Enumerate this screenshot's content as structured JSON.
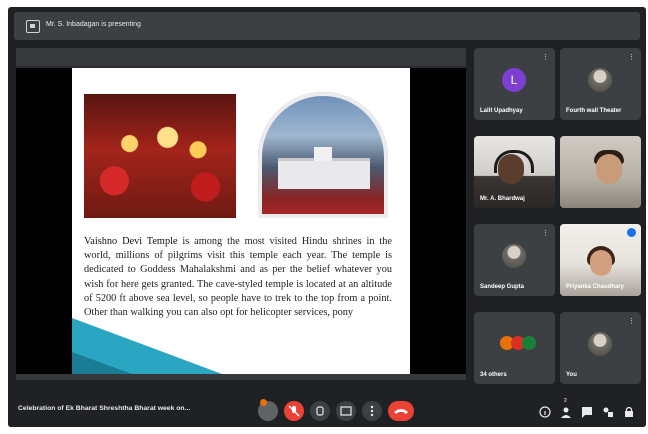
{
  "topbar": {
    "presenting": "Mr. S. Inbadagan is presenting"
  },
  "slide": {
    "body_lead": "Vaishno Devi Temple",
    "body_rest": " is among the most visited Hindu shrines in the world, millions of pilgrims visit this temple each year. The temple is dedicated to Goddess Mahalakshmi and as per the belief whatever you wish for here gets granted. The cave-styled temple is located at an altitude of 5200 ft above sea level, so people have to trek to the top from a point. Other than walking you can also opt for helicopter services, pony"
  },
  "participants": [
    {
      "name": "Lalit Upadhyay",
      "initial": "L",
      "mic": "⋮"
    },
    {
      "name": "Fourth wall Theater",
      "mic": "⋮"
    },
    {
      "name": "Mr. A. Bhardwaj"
    },
    {
      "name": ""
    },
    {
      "name": "Sandeep Gupta",
      "mic": "⋮"
    },
    {
      "name": "Priyanka Chaudhary"
    },
    {
      "name": "34 others"
    },
    {
      "name": "You",
      "mic": "⋮"
    }
  ],
  "bottombar": {
    "meeting_title": "Celebration of Ek Bharat Shreshtha Bharat week on...",
    "raise_hand_count": "2"
  },
  "colors": {
    "background": "#202124",
    "tile": "#3c4043",
    "end_call": "#ea4335",
    "active_speaker": "#8ab4f8"
  }
}
